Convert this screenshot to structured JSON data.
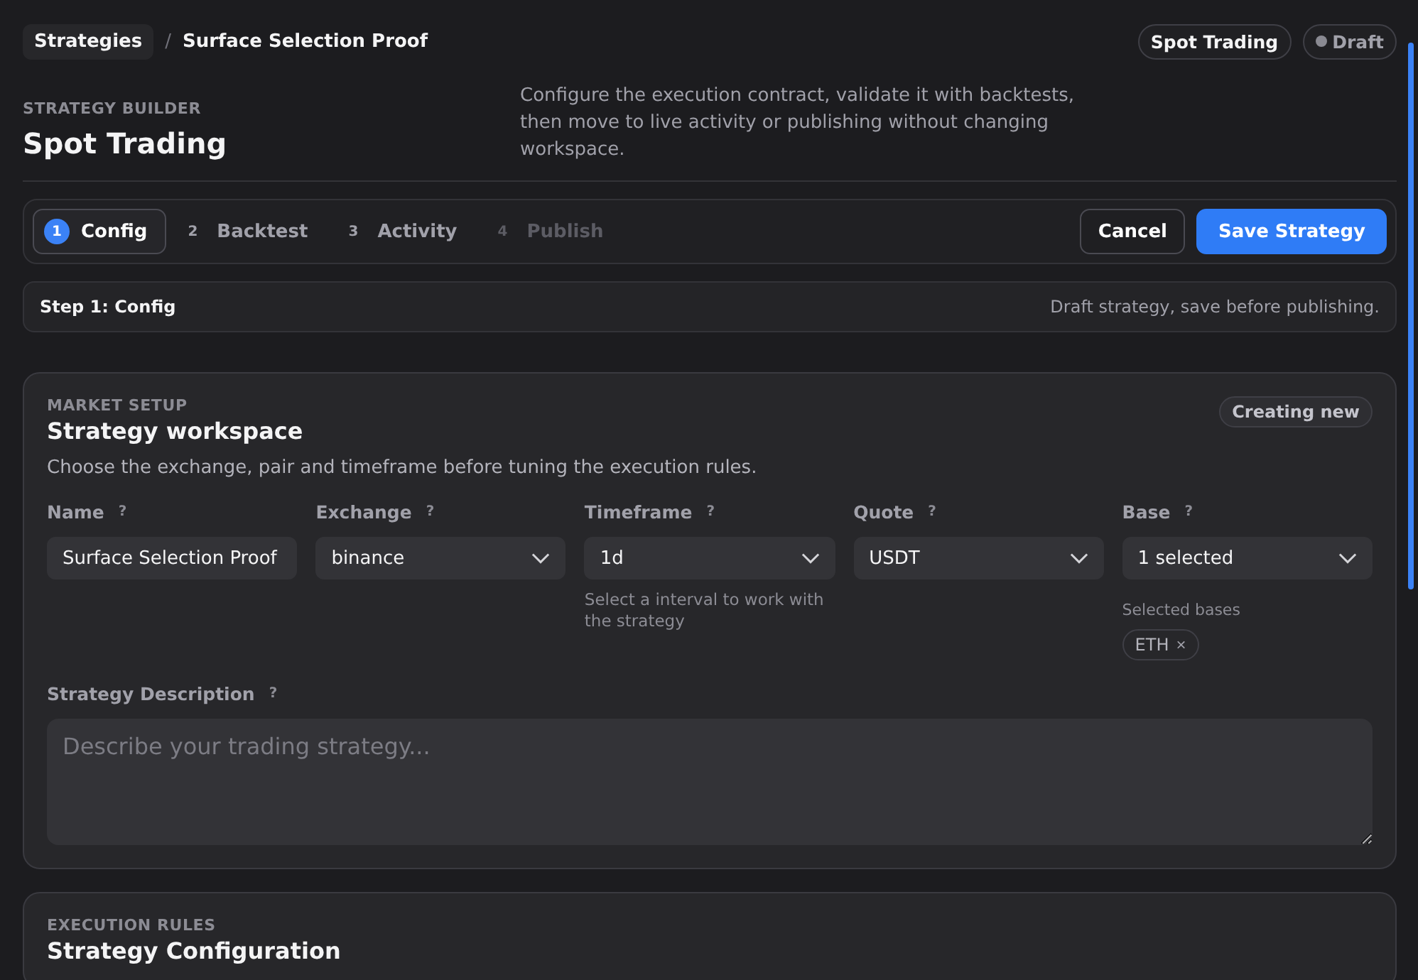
{
  "breadcrumb": {
    "items": [
      "Strategies",
      "Surface Selection Proof"
    ],
    "separator": "/"
  },
  "header_badges": {
    "market": "Spot Trading",
    "status": "Draft"
  },
  "heading": {
    "eyebrow": "STRATEGY BUILDER",
    "title": "Spot Trading",
    "description": "Configure the execution contract, validate it with backtests, then move to live activity or publishing without changing workspace."
  },
  "steps": [
    {
      "number": "1",
      "label": "Config",
      "selected": true,
      "disabled": false
    },
    {
      "number": "2",
      "label": "Backtest",
      "selected": false,
      "disabled": false
    },
    {
      "number": "3",
      "label": "Activity",
      "selected": false,
      "disabled": false
    },
    {
      "number": "4",
      "label": "Publish",
      "selected": false,
      "disabled": true
    }
  ],
  "actions": {
    "cancel": "Cancel",
    "save": "Save Strategy"
  },
  "step_info": {
    "title": "Step 1: Config",
    "note": "Draft strategy, save before publishing."
  },
  "market_setup": {
    "eyebrow": "MARKET SETUP",
    "title": "Strategy workspace",
    "badge": "Creating new",
    "description": "Choose the exchange, pair and timeframe before tuning the execution rules.",
    "fields": [
      {
        "kind": "text",
        "label": "Name",
        "help": "?",
        "value": "Surface Selection Proof"
      },
      {
        "kind": "select",
        "label": "Exchange",
        "help": "?",
        "value": "binance"
      },
      {
        "kind": "select",
        "label": "Timeframe",
        "help": "?",
        "value": "1d",
        "hint": "Select a interval to work with the strategy"
      },
      {
        "kind": "select",
        "label": "Quote",
        "help": "?",
        "value": "USDT"
      },
      {
        "kind": "select",
        "label": "Base",
        "help": "?",
        "value": "1 selected",
        "sub_label": "Selected bases",
        "chips": [
          {
            "label": "ETH",
            "remove": "×"
          }
        ]
      }
    ],
    "description_field": {
      "label": "Strategy Description",
      "help": "?",
      "placeholder": "Describe your trading strategy..."
    }
  },
  "execution_rules": {
    "eyebrow": "EXECUTION RULES",
    "title": "Strategy Configuration"
  }
}
